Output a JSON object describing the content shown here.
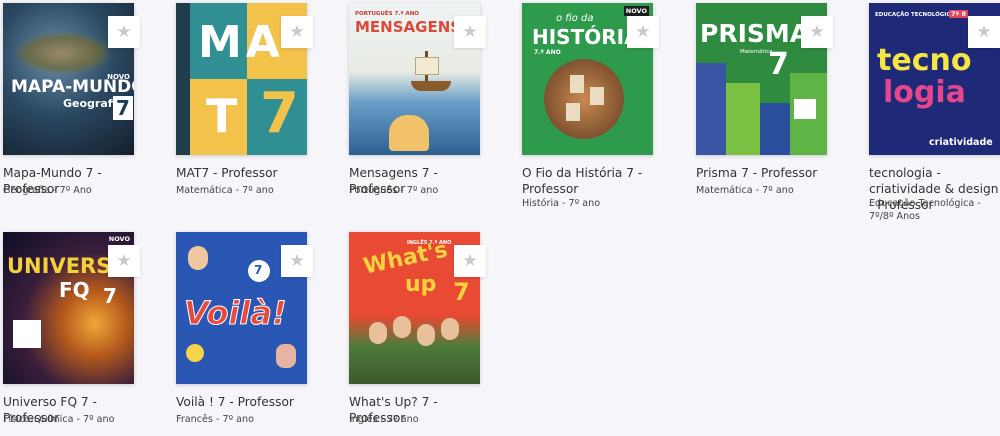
{
  "books": [
    {
      "title": "Mapa-Mundo 7 - Professor",
      "subject": "Geografia - 7º Ano",
      "cover": {
        "line1": "MAPA-MUNDO",
        "line2": "Geografia",
        "number": "7",
        "badge": "NOVO"
      }
    },
    {
      "title": "MAT7 - Professor",
      "subject": "Matemática - 7º ano",
      "cover": {
        "line1": "MA",
        "line2": "T",
        "number": "7",
        "badge": ""
      }
    },
    {
      "title": "Mensagens 7 - Professor",
      "subject": "Português - 7º ano",
      "cover": {
        "line1": "MENSAGENS",
        "line2": "PORTUGUÊS 7.º ANO",
        "number": "",
        "badge": ""
      }
    },
    {
      "title": "O Fio da História 7 - Professor",
      "subject": "História - 7º ano",
      "cover": {
        "line1": "o fio da",
        "line2": "HISTÓRIA",
        "number": "7.º ANO",
        "badge": "NOVO"
      }
    },
    {
      "title": "Prisma 7 - Professor",
      "subject": "Matemática - 7º ano",
      "cover": {
        "line1": "PRISMA",
        "line2": "Matemática",
        "number": "7",
        "badge": ""
      }
    },
    {
      "title": "tecnologia - criatividade & design - Professor",
      "subject": "Educação Tecnológica - 7º/8º Anos",
      "cover": {
        "line1": "tecno",
        "line2": "logia",
        "number": "7º 8",
        "badge": "EDUCAÇÃO TECNOLÓGICA",
        "extra": "criatividade"
      }
    },
    {
      "title": "Universo FQ 7 - Professor",
      "subject": "Físico-Química - 7º ano",
      "cover": {
        "line1": "UNIVERSO",
        "line2": "FQ",
        "number": "7",
        "badge": "NOVO"
      }
    },
    {
      "title": "Voilà ! 7 - Professor",
      "subject": "Francês - 7º ano",
      "cover": {
        "line1": "Voilà!",
        "line2": "",
        "number": "7",
        "badge": ""
      }
    },
    {
      "title": "What's Up? 7 - Professor",
      "subject": "Inglês - 7º ano",
      "cover": {
        "line1": "What's",
        "line2": "up",
        "number": "7",
        "badge": "INGLÊS 7.º ANO"
      }
    }
  ],
  "icons": {
    "favorite": "star-icon"
  },
  "colors": {
    "background": "#f6f6fa",
    "star": "#c9c9c9"
  }
}
